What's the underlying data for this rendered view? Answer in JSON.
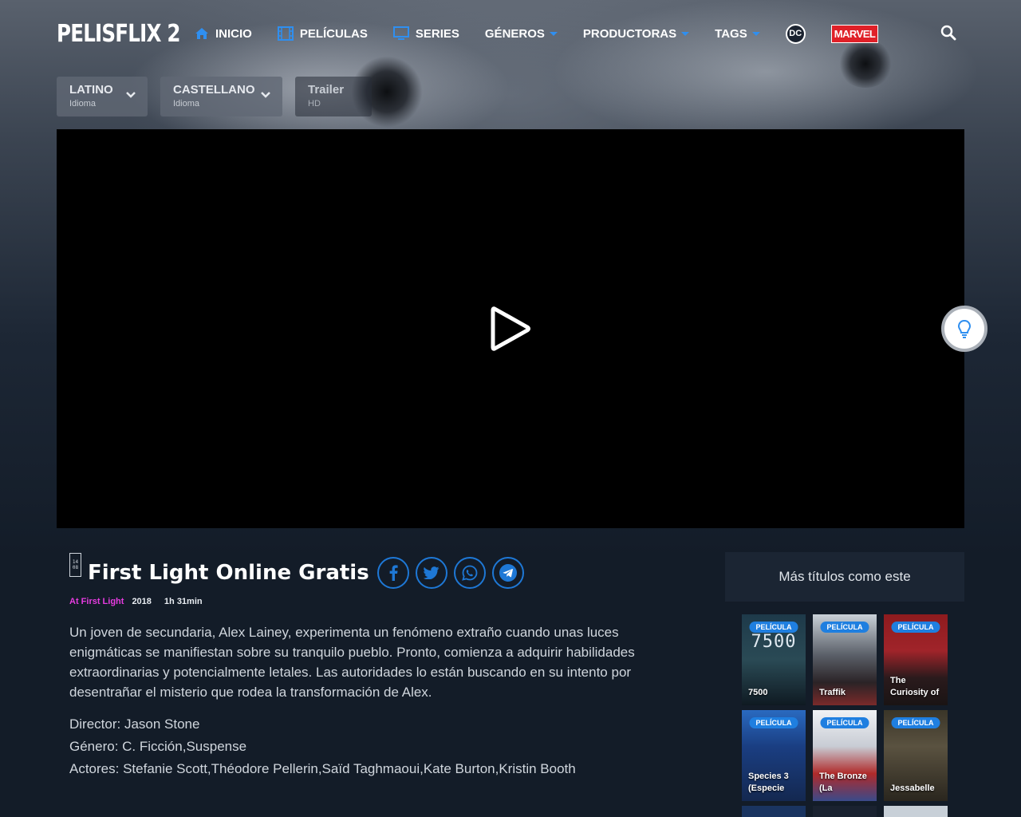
{
  "site": {
    "logo": "PELISFLIX 2"
  },
  "nav": {
    "items": [
      {
        "label": "INICIO",
        "icon": "home-icon"
      },
      {
        "label": "PELÍCULAS",
        "icon": "film-icon"
      },
      {
        "label": "SERIES",
        "icon": "tv-icon"
      },
      {
        "label": "GÉNEROS",
        "dropdown": true
      },
      {
        "label": "PRODUCTORAS",
        "dropdown": true
      },
      {
        "label": "TAGS",
        "dropdown": true
      }
    ],
    "dc_label": "DC",
    "marvel_label": "MARVEL",
    "accent": "#2f8ff0"
  },
  "languages": [
    {
      "title": "LATINO",
      "sub": "Idioma"
    },
    {
      "title": "CASTELLANO",
      "sub": "Idioma"
    },
    {
      "title": "Trailer",
      "sub": "HD"
    }
  ],
  "movie": {
    "date_badge": [
      "14",
      "08"
    ],
    "title": "First Light Online Gratis",
    "original_title": "At First Light",
    "year": "2018",
    "duration": "1h 31min",
    "synopsis": "Un joven de secundaria, Alex Lainey, experimenta un fenómeno extraño cuando unas luces enigmáticas se manifiestan sobre su tranquilo pueblo. Pronto, comienza a adquirir habilidades extraordinarias y potencialmente letales. Las autoridades lo están buscando en su intento por desentrañar el misterio que rodea la transformación de Alex.",
    "director": "Director: Jason Stone",
    "genre": "Género: C. Ficción,Suspense",
    "actors": "Actores: Stefanie Scott,Théodore Pellerin,Saïd Taghmaoui,Kate Burton,Kristin Booth"
  },
  "sidebar": {
    "heading": "Más títulos como este",
    "cards": [
      {
        "badge": "PELÍCULA",
        "title": "7500",
        "poster_text": "7500"
      },
      {
        "badge": "PELÍCULA",
        "title": "Traffik"
      },
      {
        "badge": "PELÍCULA",
        "title": "The Curiosity of"
      },
      {
        "badge": "PELÍCULA",
        "title": "Species 3 (Especie"
      },
      {
        "badge": "PELÍCULA",
        "title": "The Bronze (La"
      },
      {
        "badge": "PELÍCULA",
        "title": "Jessabelle"
      }
    ]
  }
}
